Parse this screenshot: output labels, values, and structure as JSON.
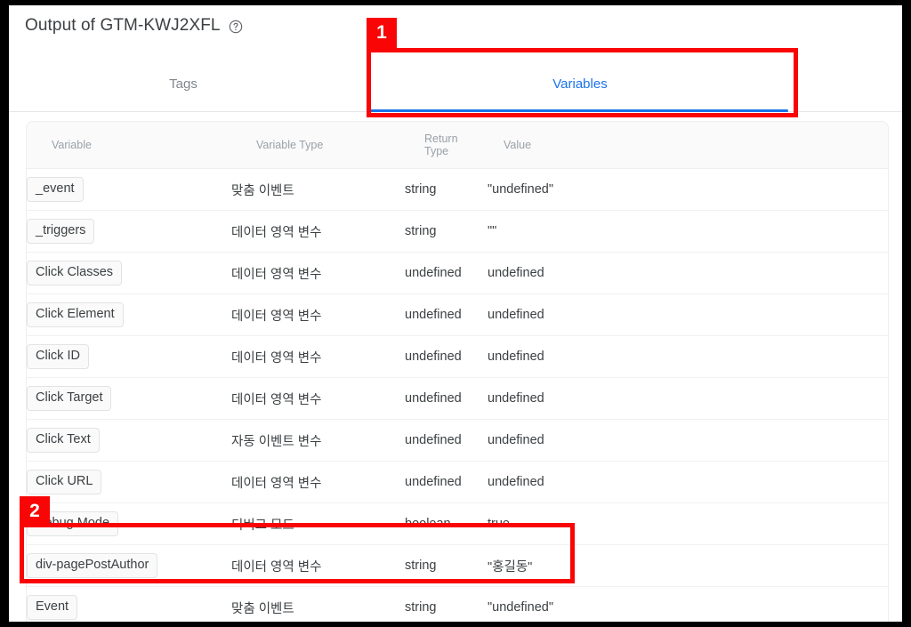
{
  "header": {
    "title": "Output of GTM-KWJ2XFL",
    "help_icon": "help-circle-icon"
  },
  "tabs": [
    {
      "label": "Tags",
      "active": false
    },
    {
      "label": "Variables",
      "active": true
    }
  ],
  "table": {
    "columns": {
      "variable": "Variable",
      "variable_type": "Variable Type",
      "return_type_line1": "Return",
      "return_type_line2": "Type",
      "value": "Value"
    },
    "rows": [
      {
        "variable": "_event",
        "variable_type": "맞춤 이벤트",
        "return_type": "string",
        "value": "\"undefined\""
      },
      {
        "variable": "_triggers",
        "variable_type": "데이터 영역 변수",
        "return_type": "string",
        "value": "\"\""
      },
      {
        "variable": "Click Classes",
        "variable_type": "데이터 영역 변수",
        "return_type": "undefined",
        "value": "undefined"
      },
      {
        "variable": "Click Element",
        "variable_type": "데이터 영역 변수",
        "return_type": "undefined",
        "value": "undefined"
      },
      {
        "variable": "Click ID",
        "variable_type": "데이터 영역 변수",
        "return_type": "undefined",
        "value": "undefined"
      },
      {
        "variable": "Click Target",
        "variable_type": "데이터 영역 변수",
        "return_type": "undefined",
        "value": "undefined"
      },
      {
        "variable": "Click Text",
        "variable_type": "자동 이벤트 변수",
        "return_type": "undefined",
        "value": "undefined"
      },
      {
        "variable": "Click URL",
        "variable_type": "데이터 영역 변수",
        "return_type": "undefined",
        "value": "undefined"
      },
      {
        "variable": "Debug Mode",
        "variable_type": "디버그 모드",
        "return_type": "boolean",
        "value": "true"
      },
      {
        "variable": "div-pagePostAuthor",
        "variable_type": "데이터 영역 변수",
        "return_type": "string",
        "value": "\"홍길동\""
      },
      {
        "variable": "Event",
        "variable_type": "맞춤 이벤트",
        "return_type": "string",
        "value": "\"undefined\""
      }
    ]
  },
  "annotations": [
    {
      "label": "1",
      "target": "variables-tab"
    },
    {
      "label": "2",
      "target": "div-pagePostAuthor-row"
    }
  ],
  "colors": {
    "accent": "#1a73e8",
    "annotation": "#f90505",
    "text": "#3c4043",
    "muted": "#80868b"
  }
}
